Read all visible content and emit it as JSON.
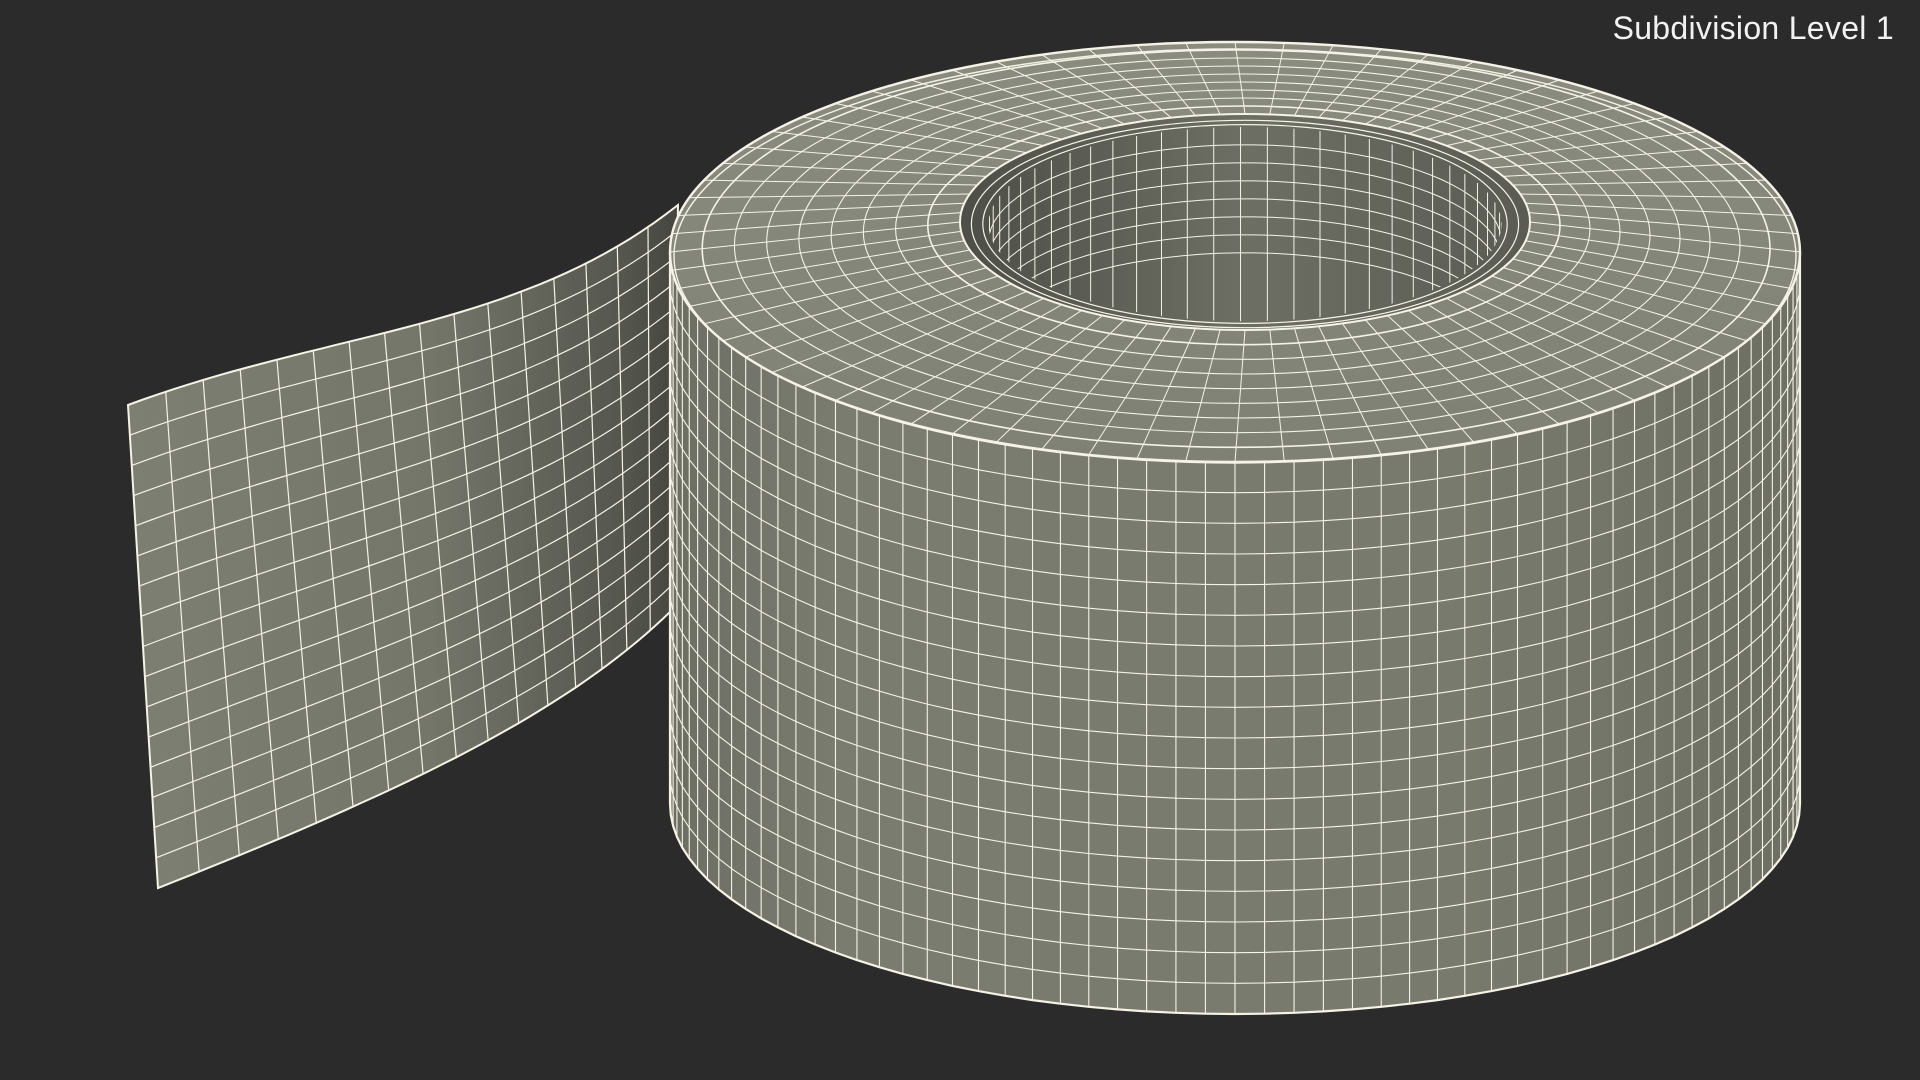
{
  "viewport": {
    "caption": "Subdivision Level 1",
    "background_color": "#2b2b2b",
    "mesh_fill_color": "#787a6d",
    "wire_color": "#f4f3e6"
  },
  "subject": {
    "icon": "tape-roll-wireframe"
  }
}
